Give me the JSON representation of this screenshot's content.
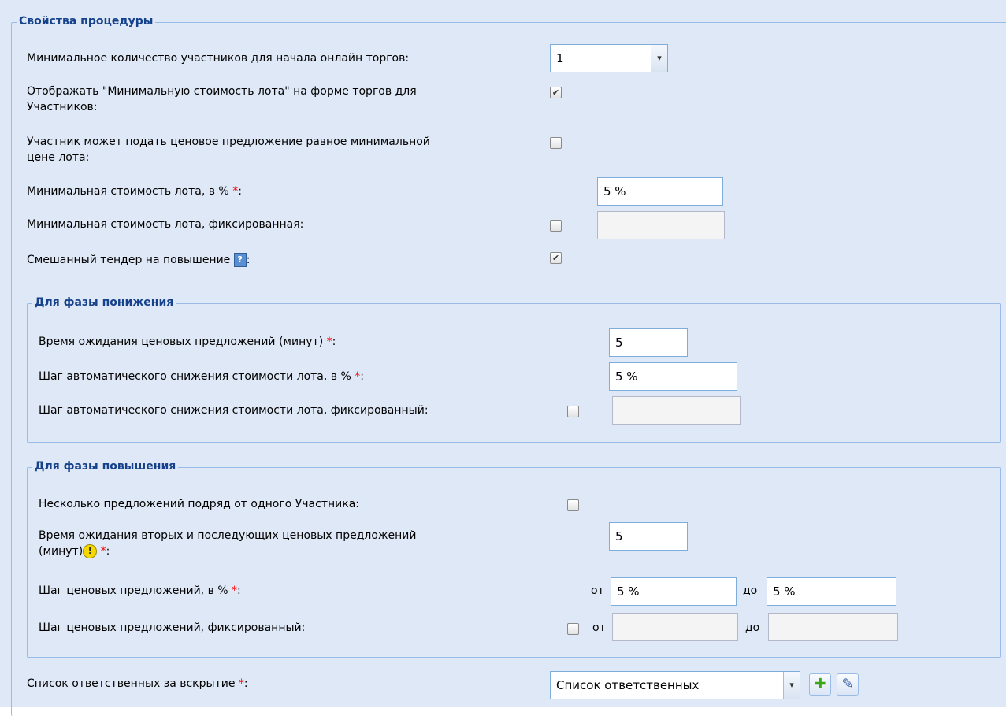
{
  "procedure": {
    "legend": "Свойства процедуры",
    "min_participants": {
      "label": "Минимальное количество участников для начала онлайн торгов:",
      "value": "1"
    },
    "show_min_cost": {
      "label_line1": "Отображать \"Минимальную стоимость лота\" на форме торгов для",
      "label_line2": "Участников:",
      "checked": true,
      "mark": "✔"
    },
    "equal_min_price": {
      "label_line1": "Участник может подать ценовое предложение равное минимальной",
      "label_line2": "цене лота:",
      "checked": false
    },
    "min_cost_percent": {
      "label": "Минимальная стоимость лота, в %",
      "required": "*",
      "colon": ":",
      "value": "5 %"
    },
    "min_cost_fixed": {
      "label": "Минимальная стоимость лота, фиксированная:",
      "checked": false,
      "value": ""
    },
    "mixed_tender": {
      "label": "Смешанный тендер на повышение",
      "colon": ":",
      "icon": "help-icon",
      "icon_glyph": "?",
      "checked": true,
      "mark": "✔"
    }
  },
  "decrease_phase": {
    "legend": "Для фазы понижения",
    "wait_time": {
      "label": "Время ожидания ценовых предложений (минут)",
      "required": "*",
      "colon": ":",
      "value": "5"
    },
    "step_percent": {
      "label": "Шаг автоматического снижения стоимости лота, в %",
      "required": "*",
      "colon": ":",
      "value": "5 %"
    },
    "step_fixed": {
      "label": "Шаг автоматического снижения стоимости лота, фиксированный:",
      "checked": false,
      "value": ""
    }
  },
  "increase_phase": {
    "legend": "Для фазы повышения",
    "multiple_bids": {
      "label": "Несколько предложений подряд от одного Участника:",
      "checked": false
    },
    "second_wait": {
      "label_line1": "Время ожидания вторых и последующих ценовых предложений",
      "label_line2": "(минут)",
      "icon": "warning-icon",
      "icon_glyph": "!",
      "required": "*",
      "colon": ":",
      "value": "5"
    },
    "bid_step_percent": {
      "label": "Шаг ценовых предложений, в %",
      "required": "*",
      "colon": ":",
      "from_label": "от",
      "from_value": "5 %",
      "to_label": "до",
      "to_value": "5 %"
    },
    "bid_step_fixed": {
      "label": "Шаг ценовых предложений, фиксированный:",
      "checked": false,
      "from_label": "от",
      "from_value": "",
      "to_label": "до",
      "to_value": ""
    }
  },
  "responsible": {
    "label": "Список ответственных за вскрытие",
    "required": "*",
    "colon": ":",
    "value": "Список ответственных",
    "add_glyph": "✚",
    "edit_glyph": "✎"
  },
  "icons": {
    "dropdown_arrow": "▾"
  },
  "colors": {
    "panel_bg": "#dfe8f6",
    "legend": "#15428b",
    "border": "#99bbe8",
    "required": "#ff0000"
  }
}
